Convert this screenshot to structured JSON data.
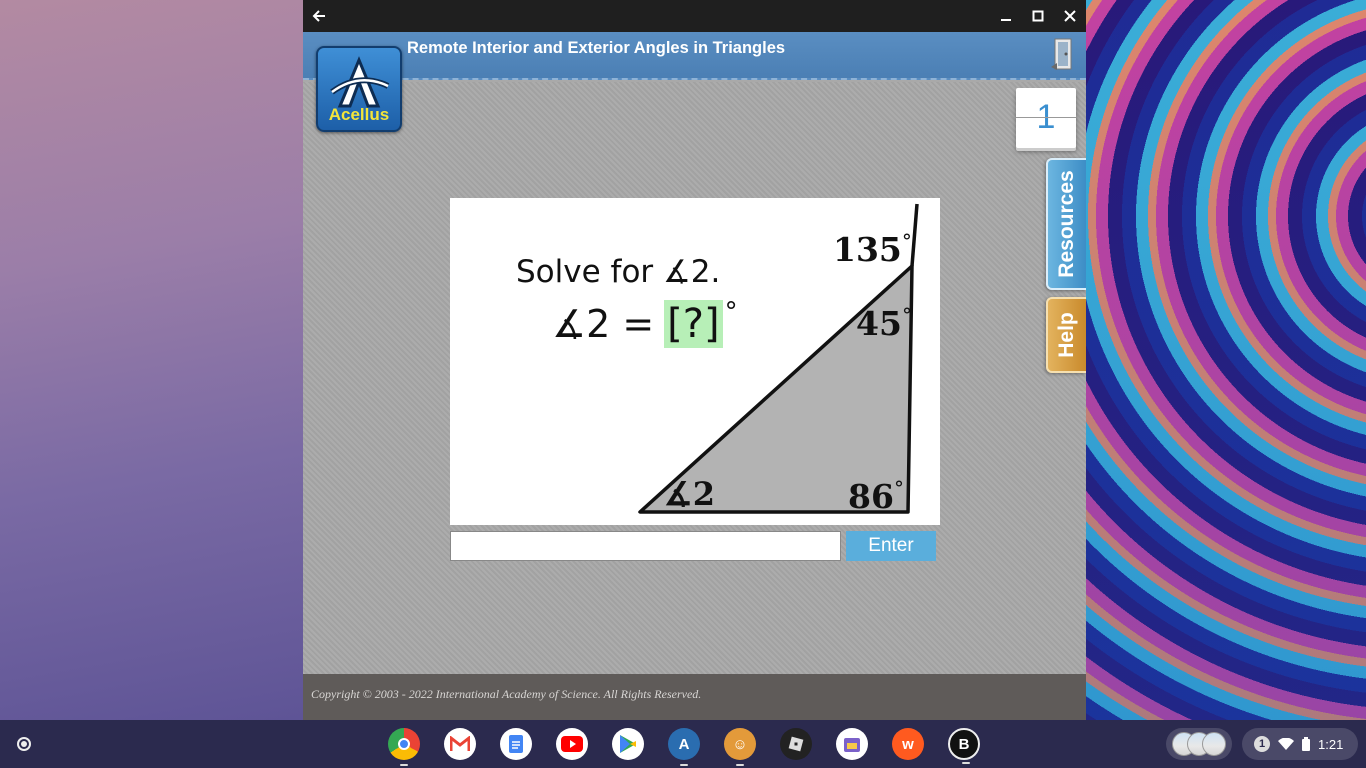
{
  "window": {
    "title": "Remote Interior and Exterior Angles in Triangles",
    "logo_text": "Acellus",
    "counter": "1",
    "tabs": {
      "resources": "Resources",
      "help": "Help"
    }
  },
  "question": {
    "line1": "Solve for ∡2.",
    "line2_prefix": "∡2 =",
    "answer_placeholder": "[?]",
    "degree": "°",
    "labels": {
      "exterior": "135",
      "top": "45",
      "right": "86",
      "left": "∡2"
    }
  },
  "answer_form": {
    "input_value": "",
    "enter_label": "Enter"
  },
  "footer": {
    "copyright": "Copyright © 2003 - 2022 International Academy of Science.  All Rights Reserved."
  },
  "shelf": {
    "apps": [
      "chrome-icon",
      "gmail-icon",
      "docs-icon",
      "youtube-icon",
      "play-store-icon",
      "acellus-icon",
      "game-icon",
      "roblox-icon",
      "calendar-app-icon",
      "wattpad-icon",
      "b-app-icon"
    ],
    "notification_count": "1",
    "time": "1:21"
  },
  "colors": {
    "header_blue": "#4b7fb4",
    "enter_blue": "#5aaedc",
    "answer_green": "#b7efb7",
    "resources_tab": "#3d8dc6",
    "help_tab": "#c98a2c"
  }
}
